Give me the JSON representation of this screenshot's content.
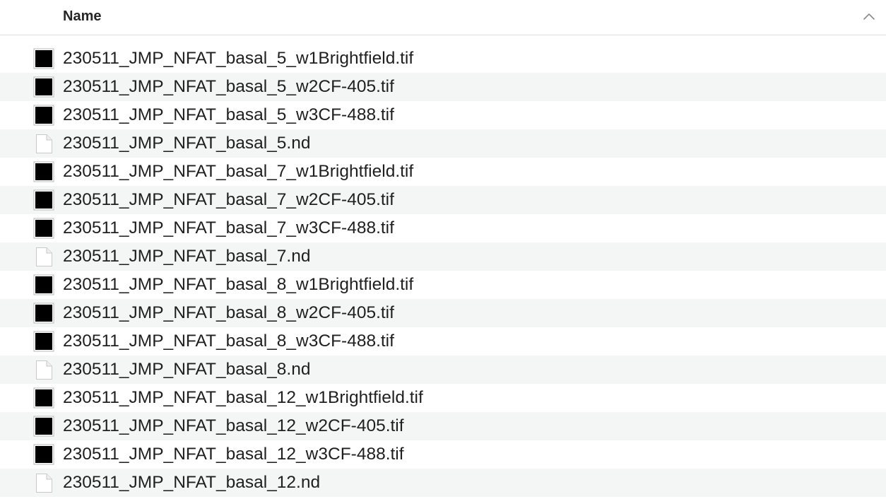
{
  "header": {
    "column_name": "Name",
    "sort_direction": "ascending",
    "sort_icon": "chevron-up-icon"
  },
  "files": [
    {
      "name": "230511_JMP_NFAT_basal_5_w1Brightfield.tif",
      "icon": "tif-thumbnail-icon"
    },
    {
      "name": "230511_JMP_NFAT_basal_5_w2CF-405.tif",
      "icon": "tif-thumbnail-icon"
    },
    {
      "name": "230511_JMP_NFAT_basal_5_w3CF-488.tif",
      "icon": "tif-thumbnail-icon"
    },
    {
      "name": "230511_JMP_NFAT_basal_5.nd",
      "icon": "blank-document-icon"
    },
    {
      "name": "230511_JMP_NFAT_basal_7_w1Brightfield.tif",
      "icon": "tif-thumbnail-icon"
    },
    {
      "name": "230511_JMP_NFAT_basal_7_w2CF-405.tif",
      "icon": "tif-thumbnail-icon"
    },
    {
      "name": "230511_JMP_NFAT_basal_7_w3CF-488.tif",
      "icon": "tif-thumbnail-icon"
    },
    {
      "name": "230511_JMP_NFAT_basal_7.nd",
      "icon": "blank-document-icon"
    },
    {
      "name": "230511_JMP_NFAT_basal_8_w1Brightfield.tif",
      "icon": "tif-thumbnail-icon"
    },
    {
      "name": "230511_JMP_NFAT_basal_8_w2CF-405.tif",
      "icon": "tif-thumbnail-icon"
    },
    {
      "name": "230511_JMP_NFAT_basal_8_w3CF-488.tif",
      "icon": "tif-thumbnail-icon"
    },
    {
      "name": "230511_JMP_NFAT_basal_8.nd",
      "icon": "blank-document-icon"
    },
    {
      "name": "230511_JMP_NFAT_basal_12_w1Brightfield.tif",
      "icon": "tif-thumbnail-icon"
    },
    {
      "name": "230511_JMP_NFAT_basal_12_w2CF-405.tif",
      "icon": "tif-thumbnail-icon"
    },
    {
      "name": "230511_JMP_NFAT_basal_12_w3CF-488.tif",
      "icon": "tif-thumbnail-icon"
    },
    {
      "name": "230511_JMP_NFAT_basal_12.nd",
      "icon": "blank-document-icon"
    }
  ],
  "colors": {
    "row_alternate": "#f4f5f5",
    "text": "#1f1f1f",
    "header_text": "#262626",
    "divider": "#dcdcdc"
  }
}
